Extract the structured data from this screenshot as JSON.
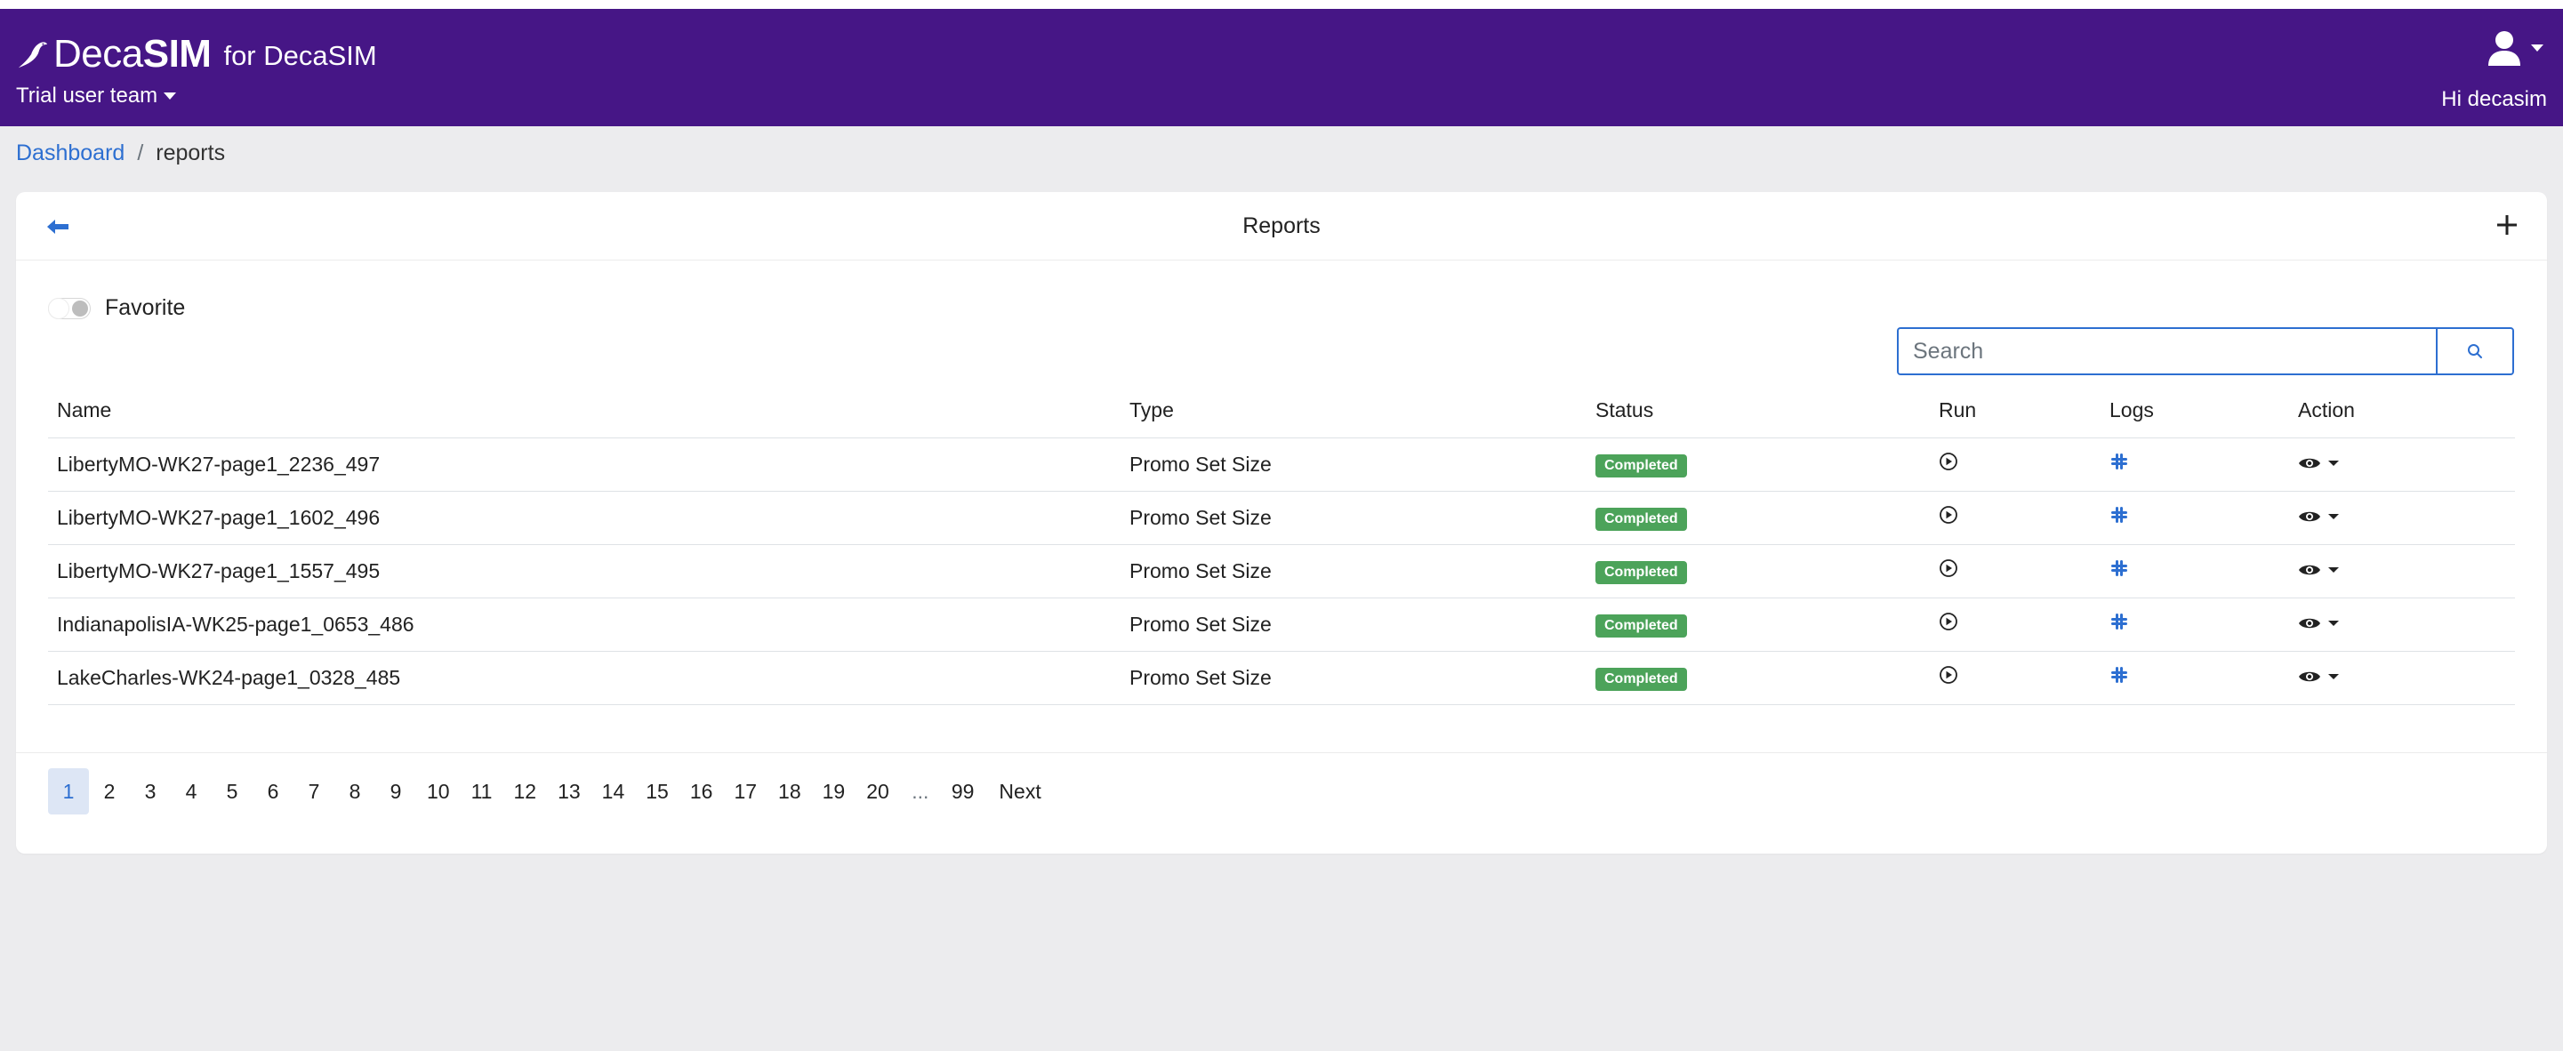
{
  "navbar": {
    "logo_part1": "Deca",
    "logo_part2": "SIM",
    "for_text": "for DecaSIM",
    "team_label": "Trial user team",
    "greeting": "Hi decasim"
  },
  "breadcrumb": {
    "home": "Dashboard",
    "separator": "/",
    "current": "reports"
  },
  "card": {
    "title": "Reports"
  },
  "favorite_label": "Favorite",
  "search": {
    "placeholder": "Search",
    "value": ""
  },
  "table": {
    "headers": {
      "name": "Name",
      "type": "Type",
      "status": "Status",
      "run": "Run",
      "logs": "Logs",
      "action": "Action"
    },
    "rows": [
      {
        "name": "LibertyMO-WK27-page1_2236_497",
        "type": "Promo Set Size",
        "status": "Completed"
      },
      {
        "name": "LibertyMO-WK27-page1_1602_496",
        "type": "Promo Set Size",
        "status": "Completed"
      },
      {
        "name": "LibertyMO-WK27-page1_1557_495",
        "type": "Promo Set Size",
        "status": "Completed"
      },
      {
        "name": "IndianapolisIA-WK25-page1_0653_486",
        "type": "Promo Set Size",
        "status": "Completed"
      },
      {
        "name": "LakeCharles-WK24-page1_0328_485",
        "type": "Promo Set Size",
        "status": "Completed"
      }
    ]
  },
  "pagination": {
    "pages": [
      "1",
      "2",
      "3",
      "4",
      "5",
      "6",
      "7",
      "8",
      "9",
      "10",
      "11",
      "12",
      "13",
      "14",
      "15",
      "16",
      "17",
      "18",
      "19",
      "20",
      "...",
      "99"
    ],
    "active": "1",
    "next_label": "Next"
  },
  "colors": {
    "navbar": "#461686",
    "link": "#2d6fd1",
    "badge_completed": "#4ca35a",
    "page_bg": "#ececee"
  },
  "icons": {
    "logo": "bird-icon",
    "user": "user-icon",
    "back": "arrow-left-icon",
    "add": "plus-icon",
    "search": "search-icon",
    "run": "play-circle-icon",
    "logs": "slack-icon",
    "action": "eye-icon"
  }
}
